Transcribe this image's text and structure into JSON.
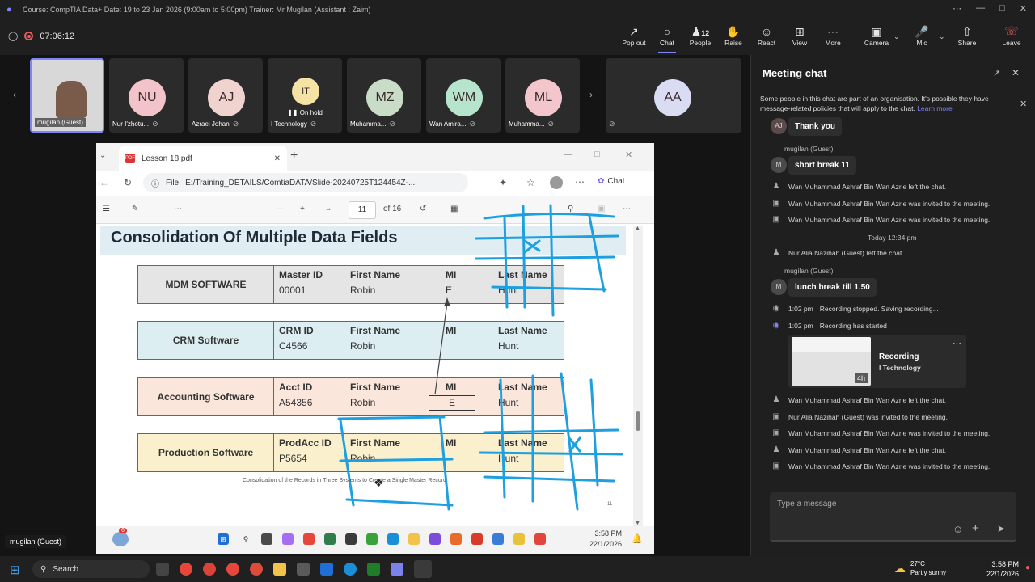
{
  "window": {
    "title": "Course: CompTIA Data+ Date: 19 to 23 Jan 2026 (9:00am to 5:00pm) Trainer: Mr Mugilan (Assistant : Zaim)"
  },
  "toolbar": {
    "timer": "07:06:12",
    "buttons": [
      {
        "label": "Pop out",
        "icon": "pop-out-icon"
      },
      {
        "label": "Chat",
        "icon": "chat-icon"
      },
      {
        "label": "People",
        "icon": "people-icon",
        "count": "12"
      },
      {
        "label": "Raise",
        "icon": "raise-hand-icon"
      },
      {
        "label": "React",
        "icon": "react-icon"
      },
      {
        "label": "View",
        "icon": "view-icon"
      },
      {
        "label": "More",
        "icon": "more-icon"
      },
      {
        "label": "Camera",
        "icon": "camera-off-icon"
      },
      {
        "label": "Mic",
        "icon": "mic-off-icon"
      },
      {
        "label": "Share",
        "icon": "share-icon"
      },
      {
        "label": "Leave",
        "icon": "leave-phone-icon"
      }
    ]
  },
  "participants": [
    {
      "name": "mugilan (Guest)",
      "initials": "",
      "color": "#cfcfcf"
    },
    {
      "name": "Nur I'zhotu...",
      "initials": "NU",
      "color": "#f2c3c8"
    },
    {
      "name": "Azraei Johan",
      "initials": "AJ",
      "color": "#f0d2cf"
    },
    {
      "name": "I Technology",
      "initials": "IT",
      "color": "#f5e3a6",
      "status": "On hold"
    },
    {
      "name": "Muhamma...",
      "initials": "MZ",
      "color": "#c8dcc7"
    },
    {
      "name": "Wan Amira...",
      "initials": "WM",
      "color": "#b6e4cd"
    },
    {
      "name": "Muhamma...",
      "initials": "ML",
      "color": "#f2c6cc"
    },
    {
      "name": "",
      "initials": "AA",
      "color": "#d9dcf3"
    }
  ],
  "browser": {
    "tab_title": "Lesson 18.pdf",
    "file_label": "File",
    "url": "E:/Training_DETAILS/ComtiaDATA/Slide-20240725T124454Z-...",
    "chat_label": "Chat",
    "page_current": "11",
    "page_total": "of 16"
  },
  "slide": {
    "title": "Consolidation Of Multiple Data Fields",
    "systems": [
      {
        "name": "MDM SOFTWARE",
        "id_label": "Master ID",
        "id_value": "00001",
        "first_label": "First Name",
        "first_value": "Robin",
        "mi_label": "MI",
        "mi_value": "E",
        "last_label": "Last Name",
        "last_value": "Hunt",
        "color": "#e5e5e5"
      },
      {
        "name": "CRM Software",
        "id_label": "CRM ID",
        "id_value": "C4566",
        "first_label": "First Name",
        "first_value": "Robin",
        "mi_label": "MI",
        "mi_value": "",
        "last_label": "Last Name",
        "last_value": "Hunt",
        "color": "#ddeef3"
      },
      {
        "name": "Accounting Software",
        "id_label": "Acct ID",
        "id_value": "A54356",
        "first_label": "First Name",
        "first_value": "Robin",
        "mi_label": "MI",
        "mi_value": "E",
        "last_label": "Last Name",
        "last_value": "Hunt",
        "color": "#fbe6dc"
      },
      {
        "name": "Production Software",
        "id_label": "ProdAcc ID",
        "id_value": "P5654",
        "first_label": "First Name",
        "first_value": "Robin",
        "mi_label": "MI",
        "mi_value": "",
        "last_label": "Last Name",
        "last_value": "Hunt",
        "color": "#faf0cd"
      }
    ],
    "caption": "Consolidation of the Records in Three Systems to Create a Single Master Record",
    "page_number": "11"
  },
  "inner_taskbar": {
    "time": "3:58 PM",
    "date": "22/1/2026",
    "badge": "6"
  },
  "presenter_label": "mugilan (Guest)",
  "chat": {
    "title": "Meeting chat",
    "notice": "Some people in this chat are part of an organisation. It's possible they have message-related policies that will apply to the chat.",
    "learn_more": "Learn more",
    "messages": {
      "m1": "Thank you",
      "m1_avatar": "AJ",
      "sender2": "mugilan (Guest)",
      "m2": "short break 11",
      "e1": "Wan Muhammad Ashraf Bin Wan Azrie left the chat.",
      "e2": "Wan Muhammad Ashraf Bin Wan Azrie was invited to the meeting.",
      "e3": "Wan Muhammad Ashraf Bin Wan Azrie was invited to the meeting.",
      "divider": "Today 12:34 pm",
      "e4": "Nur Alia Nazihah (Guest) left the chat.",
      "sender3": "mugilan (Guest)",
      "m3": "lunch break till 1.50",
      "r1_time": "1:02 pm",
      "r1": "Recording stopped. Saving recording...",
      "r2_time": "1:02 pm",
      "r2": "Recording has started",
      "rec_title": "Recording",
      "rec_sub": "I Technology",
      "rec_duration": "4h",
      "e5": "Wan Muhammad Ashraf Bin Wan Azrie left the chat.",
      "e6": "Nur Alia Nazihah (Guest) was invited to the meeting.",
      "e7": "Wan Muhammad Ashraf Bin Wan Azrie was invited to the meeting.",
      "e8": "Wan Muhammad Ashraf Bin Wan Azrie left the chat.",
      "e9": "Wan Muhammad Ashraf Bin Wan Azrie was invited to the meeting."
    },
    "compose_placeholder": "Type a message"
  },
  "taskbar": {
    "search": "Search",
    "temp": "27°C",
    "weather": "Partly sunny",
    "time": "3:58 PM",
    "date": "22/1/2026"
  }
}
